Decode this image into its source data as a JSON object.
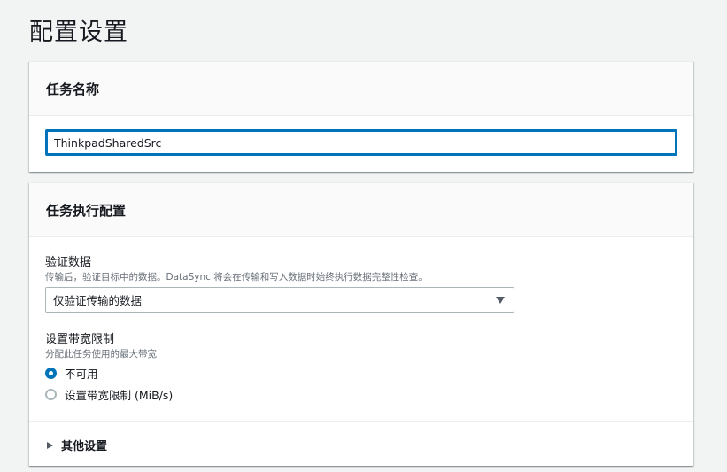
{
  "page": {
    "title": "配置设置"
  },
  "task_name": {
    "heading": "任务名称",
    "input_value": "ThinkpadSharedSrc"
  },
  "execution": {
    "heading": "任务执行配置",
    "verify": {
      "label": "验证数据",
      "description": "传输后，验证目标中的数据。DataSync 将会在传输和写入数据时始终执行数据完整性检查。",
      "selected": "仅验证传输的数据"
    },
    "bandwidth": {
      "label": "设置带宽限制",
      "description": "分配此任务使用的最大带宽",
      "options": [
        {
          "label": "不可用",
          "checked": true
        },
        {
          "label": "设置带宽限制 (MiB/s)",
          "checked": false
        }
      ]
    },
    "additional": {
      "label": "其他设置"
    }
  },
  "colors": {
    "accent": "#0073bb",
    "background": "#f2f3f3",
    "secondary_text": "#687078"
  },
  "icons": {
    "select_caret": "caret-down-icon",
    "expander_caret": "caret-right-icon"
  }
}
